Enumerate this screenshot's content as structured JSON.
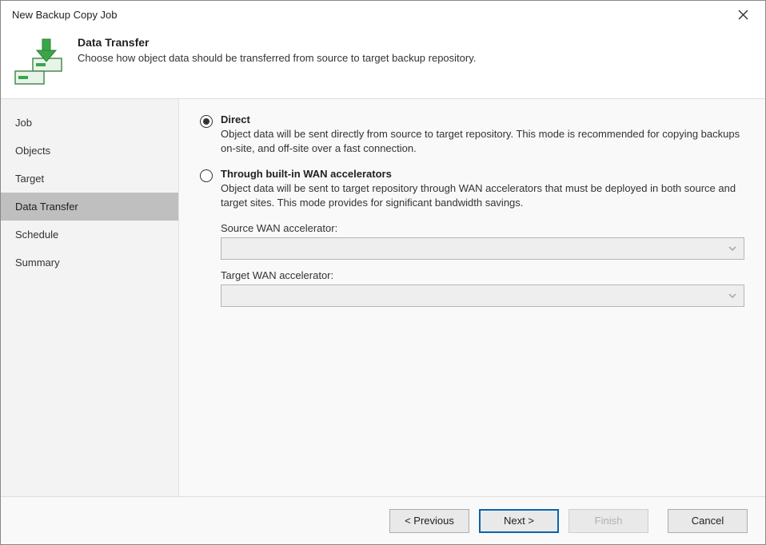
{
  "window": {
    "title": "New Backup Copy Job"
  },
  "header": {
    "title": "Data Transfer",
    "subtitle": "Choose how object data should be transferred from source to target backup repository."
  },
  "sidebar": {
    "items": [
      {
        "label": "Job"
      },
      {
        "label": "Objects"
      },
      {
        "label": "Target"
      },
      {
        "label": "Data Transfer",
        "active": true
      },
      {
        "label": "Schedule"
      },
      {
        "label": "Summary"
      }
    ]
  },
  "options": {
    "direct": {
      "label": "Direct",
      "desc": "Object data will be sent directly from source to target repository. This mode is recommended for copying backups on-site, and off-site over a fast connection.",
      "selected": true
    },
    "wan": {
      "label": "Through built-in WAN accelerators",
      "desc": "Object data will be sent to target repository through WAN accelerators that must be deployed in both source and target sites. This mode provides for significant bandwidth savings.",
      "selected": false
    }
  },
  "fields": {
    "source_label": "Source WAN accelerator:",
    "source_value": "",
    "target_label": "Target WAN accelerator:",
    "target_value": ""
  },
  "buttons": {
    "previous": "< Previous",
    "next": "Next >",
    "finish": "Finish",
    "cancel": "Cancel"
  }
}
